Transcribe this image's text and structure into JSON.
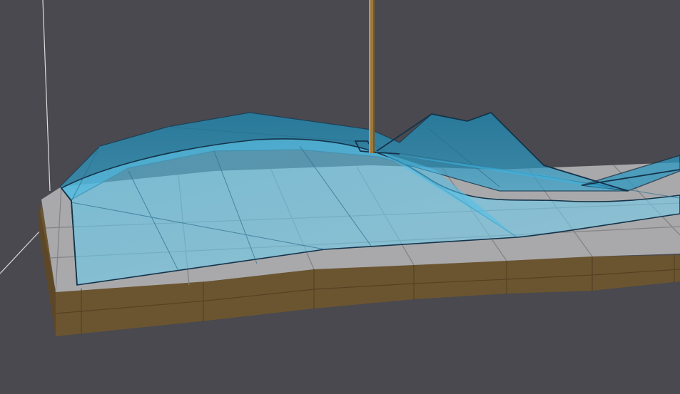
{
  "scene": {
    "view": "3d-viewport",
    "colors": {
      "background": "#4a494f",
      "slab_top": "#a9a9ab",
      "slab_side": "#6b5530",
      "slab_side_dark": "#5c4828",
      "slab_grid": "#7a7a7c",
      "mesh_fill": "#5ec8ec",
      "mesh_fill_dark": "#2f9cc4",
      "mesh_outline": "#14344a",
      "pole": "#9c7a3e",
      "axis_line": "#d8d8d8"
    },
    "objects": [
      "ground-slab",
      "translucent-mesh-surface",
      "vertical-pole",
      "axis-guide"
    ]
  }
}
